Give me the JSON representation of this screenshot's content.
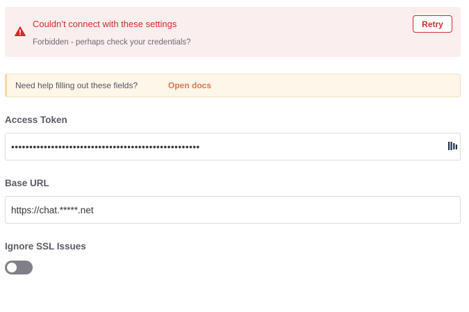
{
  "error": {
    "title": "Couldn’t connect with these settings",
    "detail": "Forbidden - perhaps check your credentials?",
    "retry_label": "Retry",
    "icon": "warning-triangle-icon",
    "color": "#d12b2b"
  },
  "notice": {
    "text": "Need help filling out these fields?",
    "link_label": "Open docs",
    "link_color": "#e0734b"
  },
  "fields": {
    "access_token": {
      "label": "Access Token",
      "value": "••••••••••••••••••••••••••••••••••••••••••••••••••••",
      "icon": "password-manager-icon"
    },
    "base_url": {
      "label": "Base URL",
      "value": "https://chat.*****.net"
    },
    "ignore_ssl": {
      "label": "Ignore SSL Issues",
      "enabled": false
    }
  }
}
